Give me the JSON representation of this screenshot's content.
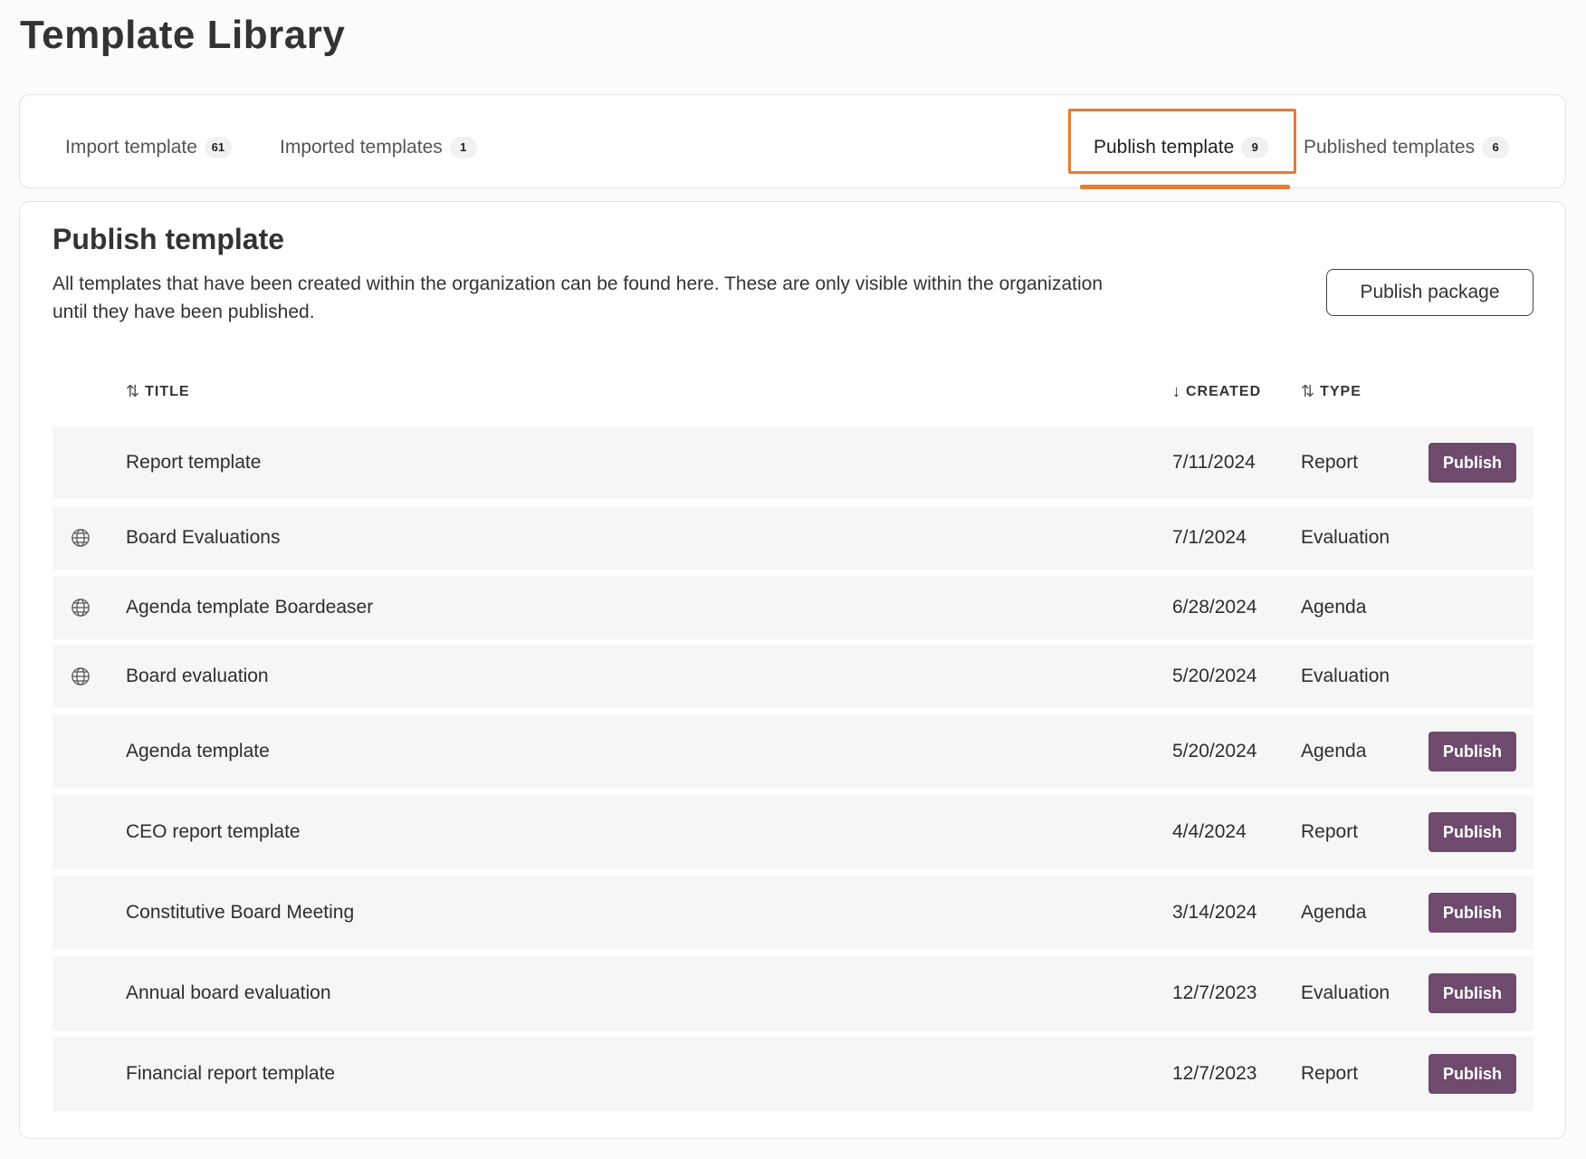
{
  "page": {
    "title": "Template Library"
  },
  "tabs": [
    {
      "label": "Import template",
      "count": "61"
    },
    {
      "label": "Imported templates",
      "count": "1"
    },
    {
      "label": "Publish template",
      "count": "9"
    },
    {
      "label": "Published templates",
      "count": "6"
    }
  ],
  "active_tab": "Publish template",
  "section": {
    "title": "Publish template",
    "description": "All templates that have been created within the organization can be found here. These are only visible within the organization until they have been published.",
    "publish_package_label": "Publish package"
  },
  "table": {
    "columns": [
      {
        "label": "TITLE",
        "sort": "sortable"
      },
      {
        "label": "CREATED",
        "sort": "descending"
      },
      {
        "label": "TYPE",
        "sort": "sortable"
      }
    ],
    "rows": [
      {
        "title": "Report template",
        "created": "7/11/2024",
        "type": "Report",
        "published_icon": false,
        "action": "Publish"
      },
      {
        "title": "Board Evaluations",
        "created": "7/1/2024",
        "type": "Evaluation",
        "published_icon": true,
        "action": ""
      },
      {
        "title": "Agenda template Boardeaser",
        "created": "6/28/2024",
        "type": "Agenda",
        "published_icon": true,
        "action": ""
      },
      {
        "title": "Board evaluation",
        "created": "5/20/2024",
        "type": "Evaluation",
        "published_icon": true,
        "action": ""
      },
      {
        "title": "Agenda template",
        "created": "5/20/2024",
        "type": "Agenda",
        "published_icon": false,
        "action": "Publish"
      },
      {
        "title": "CEO report template",
        "created": "4/4/2024",
        "type": "Report",
        "published_icon": false,
        "action": "Publish"
      },
      {
        "title": "Constitutive Board Meeting",
        "created": "3/14/2024",
        "type": "Agenda",
        "published_icon": false,
        "action": "Publish"
      },
      {
        "title": "Annual board evaluation",
        "created": "12/7/2023",
        "type": "Evaluation",
        "published_icon": false,
        "action": "Publish"
      },
      {
        "title": "Financial report template",
        "created": "12/7/2023",
        "type": "Report",
        "published_icon": false,
        "action": "Publish"
      }
    ]
  },
  "icons": {
    "published": "globe-icon",
    "sortable": "sort-arrows-icon",
    "descending": "arrow-down-icon"
  },
  "colors": {
    "accent": "#e87a34",
    "publish_button": "#6e4a6c",
    "row_bg": "#f6f6f6"
  }
}
